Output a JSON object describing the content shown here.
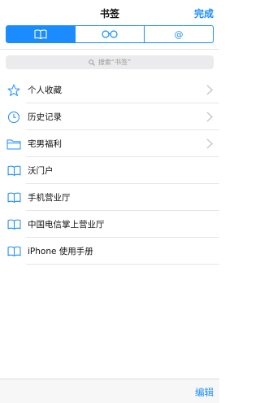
{
  "nav": {
    "title": "书签",
    "done_label": "完成"
  },
  "tabs": [
    {
      "icon": "book-icon",
      "active": true
    },
    {
      "icon": "glasses-icon",
      "active": false
    },
    {
      "icon": "at-icon",
      "active": false
    }
  ],
  "search": {
    "placeholder": "搜索“书签”"
  },
  "bookmarks": [
    {
      "icon": "star-icon",
      "label": "个人收藏",
      "has_chevron": true
    },
    {
      "icon": "clock-icon",
      "label": "历史记录",
      "has_chevron": true
    },
    {
      "icon": "folder-icon",
      "label": "宅男福利",
      "has_chevron": true
    },
    {
      "icon": "book-icon",
      "label": "沃门户",
      "has_chevron": false
    },
    {
      "icon": "book-icon",
      "label": "手机营业厅",
      "has_chevron": false
    },
    {
      "icon": "book-icon",
      "label": "中国电信掌上营业厅",
      "has_chevron": false
    },
    {
      "icon": "book-icon",
      "label": "iPhone 使用手册",
      "has_chevron": false
    }
  ],
  "toolbar": {
    "edit_label": "编辑"
  },
  "colors": {
    "accent": "#1a8cff"
  }
}
